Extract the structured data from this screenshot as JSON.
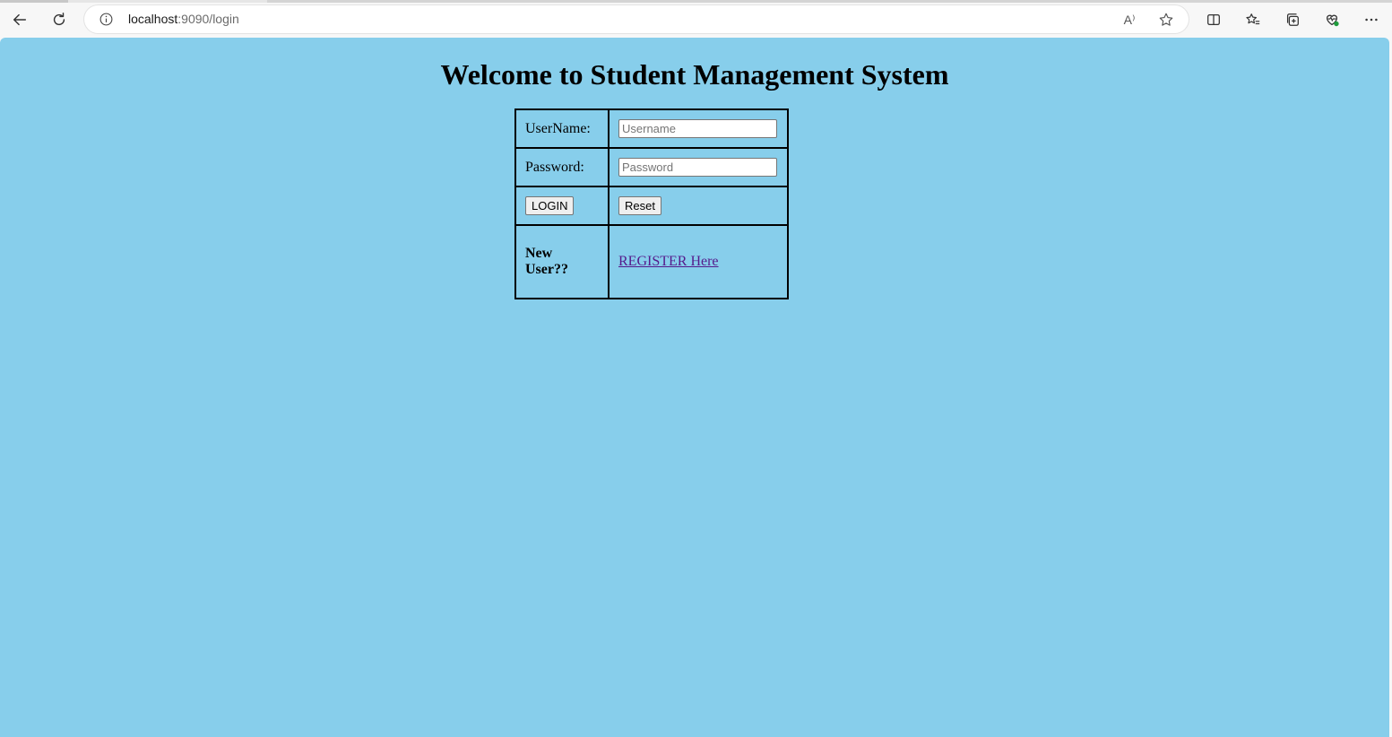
{
  "browser": {
    "url_host": "localhost",
    "url_path": ":9090/login",
    "read_aloud_label": "A⁾"
  },
  "page": {
    "heading": "Welcome to Student Management System",
    "background_color": "#87ceeb",
    "form": {
      "username_label": "UserName:",
      "username_placeholder": "Username",
      "password_label": "Password:",
      "password_placeholder": "Password",
      "login_button": "LOGIN",
      "reset_button": "Reset",
      "new_user_label": "New User??",
      "register_link": "REGISTER Here"
    }
  }
}
